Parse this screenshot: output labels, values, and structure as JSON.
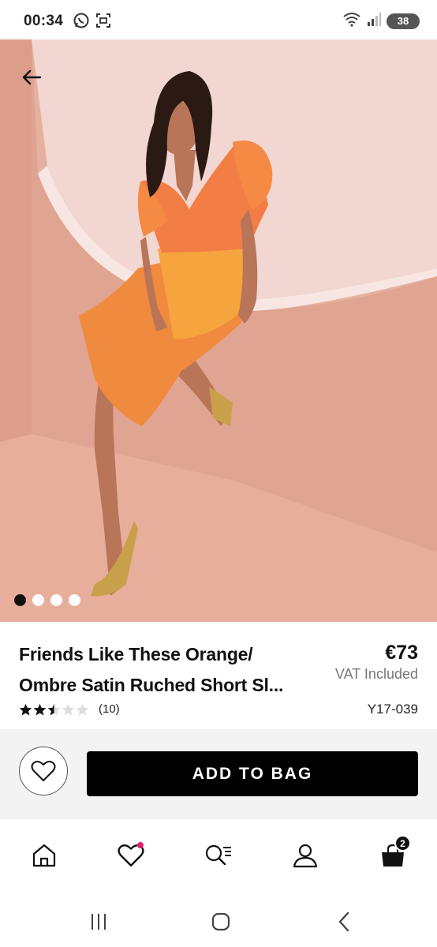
{
  "status_bar": {
    "time": "00:34",
    "battery": "38",
    "left_icons": [
      "whatsapp-icon",
      "screen-capture-icon"
    ],
    "right_icons": [
      "wifi-icon",
      "signal-icon",
      "battery-icon"
    ]
  },
  "hero": {
    "carousel_count": 4,
    "active_index": 0,
    "colors": {
      "wall": "#e9b6a5",
      "dress": "#f0853f"
    }
  },
  "product": {
    "title_line1": "Friends Like These Orange/",
    "title_line2": "Ombre Satin Ruched Short Sl...",
    "price": "€73",
    "vat": "VAT Included",
    "rating": 2.5,
    "rating_max": 5,
    "review_count": "(10)",
    "sku": "Y17-039"
  },
  "actions": {
    "add_to_bag": "ADD TO BAG"
  },
  "bottom_nav": {
    "bag_count": "2",
    "items": [
      "home-icon",
      "heart-icon",
      "search-list-icon",
      "account-icon",
      "bag-icon"
    ]
  },
  "colors": {
    "accent": "#000000",
    "wishlist_dot": "#e0206a",
    "text_muted": "#777777"
  }
}
